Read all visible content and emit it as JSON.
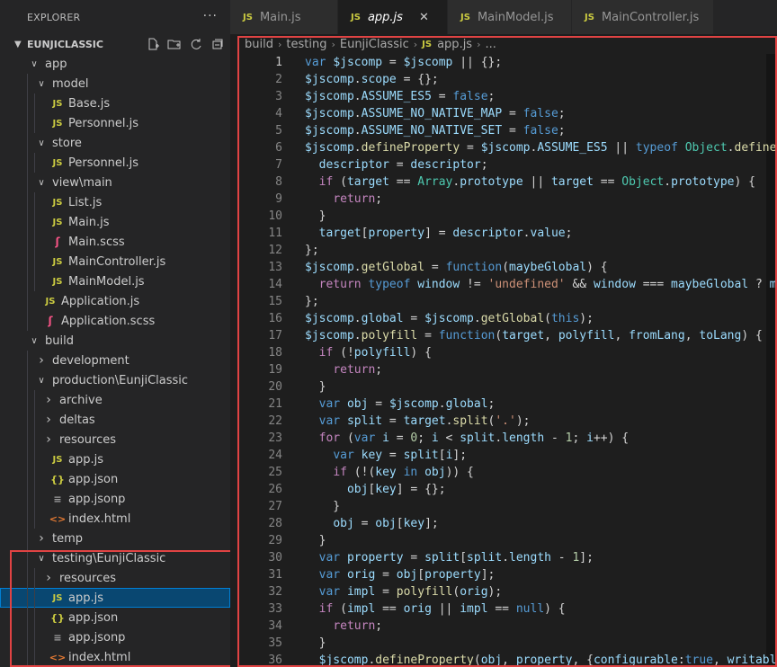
{
  "sidebar": {
    "title": "EXPLORER",
    "more": "···",
    "section": "EUNJICLASSIC",
    "tree": [
      {
        "label": "app",
        "type": "folder",
        "depth": 0,
        "open": true
      },
      {
        "label": "model",
        "type": "folder",
        "depth": 1,
        "open": true
      },
      {
        "label": "Base.js",
        "type": "js",
        "depth": 2
      },
      {
        "label": "Personnel.js",
        "type": "js",
        "depth": 2
      },
      {
        "label": "store",
        "type": "folder",
        "depth": 1,
        "open": true
      },
      {
        "label": "Personnel.js",
        "type": "js",
        "depth": 2
      },
      {
        "label": "view\\main",
        "type": "folder",
        "depth": 1,
        "open": true
      },
      {
        "label": "List.js",
        "type": "js",
        "depth": 2
      },
      {
        "label": "Main.js",
        "type": "js",
        "depth": 2
      },
      {
        "label": "Main.scss",
        "type": "sass",
        "depth": 2
      },
      {
        "label": "MainController.js",
        "type": "js",
        "depth": 2
      },
      {
        "label": "MainModel.js",
        "type": "js",
        "depth": 2
      },
      {
        "label": "Application.js",
        "type": "js",
        "depth": 1
      },
      {
        "label": "Application.scss",
        "type": "sass",
        "depth": 1
      },
      {
        "label": "build",
        "type": "folder",
        "depth": 0,
        "open": true
      },
      {
        "label": "development",
        "type": "folder",
        "depth": 1,
        "open": false
      },
      {
        "label": "production\\EunjiClassic",
        "type": "folder",
        "depth": 1,
        "open": true
      },
      {
        "label": "archive",
        "type": "folder",
        "depth": 2,
        "open": false
      },
      {
        "label": "deltas",
        "type": "folder",
        "depth": 2,
        "open": false
      },
      {
        "label": "resources",
        "type": "folder",
        "depth": 2,
        "open": false
      },
      {
        "label": "app.js",
        "type": "js",
        "depth": 2
      },
      {
        "label": "app.json",
        "type": "json",
        "depth": 2
      },
      {
        "label": "app.jsonp",
        "type": "text",
        "depth": 2
      },
      {
        "label": "index.html",
        "type": "html",
        "depth": 2
      },
      {
        "label": "temp",
        "type": "folder",
        "depth": 1,
        "open": false
      },
      {
        "label": "testing\\EunjiClassic",
        "type": "folder",
        "depth": 1,
        "open": true
      },
      {
        "label": "resources",
        "type": "folder",
        "depth": 2,
        "open": false
      },
      {
        "label": "app.js",
        "type": "js",
        "depth": 2,
        "selected": true
      },
      {
        "label": "app.json",
        "type": "json",
        "depth": 2
      },
      {
        "label": "app.jsonp",
        "type": "text",
        "depth": 2
      },
      {
        "label": "index.html",
        "type": "html",
        "depth": 2
      }
    ]
  },
  "tabs": [
    {
      "label": "Main.js",
      "active": false
    },
    {
      "label": "app.js",
      "active": true
    },
    {
      "label": "MainModel.js",
      "active": false
    },
    {
      "label": "MainController.js",
      "active": false
    }
  ],
  "icons": {
    "js": "JS",
    "json": "{}",
    "sass": "ʃ",
    "html": "<>",
    "text": "≡",
    "close": "✕"
  },
  "breadcrumb": [
    "build",
    "testing",
    "EunjiClassic",
    "app.js",
    "..."
  ],
  "editor": {
    "current_line": 1,
    "lines": [
      [
        [
          "k",
          "var "
        ],
        [
          "v",
          "$jscomp"
        ],
        [
          "p",
          " = "
        ],
        [
          "v",
          "$jscomp"
        ],
        [
          "p",
          " || {};"
        ]
      ],
      [
        [
          "v",
          "$jscomp"
        ],
        [
          "p",
          "."
        ],
        [
          "v",
          "scope"
        ],
        [
          "p",
          " = {};"
        ]
      ],
      [
        [
          "v",
          "$jscomp"
        ],
        [
          "p",
          "."
        ],
        [
          "v",
          "ASSUME_ES5"
        ],
        [
          "p",
          " = "
        ],
        [
          "k",
          "false"
        ],
        [
          "p",
          ";"
        ]
      ],
      [
        [
          "v",
          "$jscomp"
        ],
        [
          "p",
          "."
        ],
        [
          "v",
          "ASSUME_NO_NATIVE_MAP"
        ],
        [
          "p",
          " = "
        ],
        [
          "k",
          "false"
        ],
        [
          "p",
          ";"
        ]
      ],
      [
        [
          "v",
          "$jscomp"
        ],
        [
          "p",
          "."
        ],
        [
          "v",
          "ASSUME_NO_NATIVE_SET"
        ],
        [
          "p",
          " = "
        ],
        [
          "k",
          "false"
        ],
        [
          "p",
          ";"
        ]
      ],
      [
        [
          "v",
          "$jscomp"
        ],
        [
          "p",
          "."
        ],
        [
          "f",
          "defineProperty"
        ],
        [
          "p",
          " = "
        ],
        [
          "v",
          "$jscomp"
        ],
        [
          "p",
          "."
        ],
        [
          "v",
          "ASSUME_ES5"
        ],
        [
          "p",
          " || "
        ],
        [
          "k",
          "typeof "
        ],
        [
          "t",
          "Object"
        ],
        [
          "p",
          "."
        ],
        [
          "f",
          "defineProperty"
        ]
      ],
      [
        [
          "p",
          "  "
        ],
        [
          "v",
          "descriptor"
        ],
        [
          "p",
          " = "
        ],
        [
          "v",
          "descriptor"
        ],
        [
          "p",
          ";"
        ]
      ],
      [
        [
          "p",
          "  "
        ],
        [
          "c",
          "if"
        ],
        [
          "p",
          " ("
        ],
        [
          "v",
          "target"
        ],
        [
          "p",
          " == "
        ],
        [
          "t",
          "Array"
        ],
        [
          "p",
          "."
        ],
        [
          "v",
          "prototype"
        ],
        [
          "p",
          " || "
        ],
        [
          "v",
          "target"
        ],
        [
          "p",
          " == "
        ],
        [
          "t",
          "Object"
        ],
        [
          "p",
          "."
        ],
        [
          "v",
          "prototype"
        ],
        [
          "p",
          ") {"
        ]
      ],
      [
        [
          "p",
          "    "
        ],
        [
          "c",
          "return"
        ],
        [
          "p",
          ";"
        ]
      ],
      [
        [
          "p",
          "  }"
        ]
      ],
      [
        [
          "p",
          "  "
        ],
        [
          "v",
          "target"
        ],
        [
          "p",
          "["
        ],
        [
          "v",
          "property"
        ],
        [
          "p",
          "] = "
        ],
        [
          "v",
          "descriptor"
        ],
        [
          "p",
          "."
        ],
        [
          "v",
          "value"
        ],
        [
          "p",
          ";"
        ]
      ],
      [
        [
          "p",
          "};"
        ]
      ],
      [
        [
          "v",
          "$jscomp"
        ],
        [
          "p",
          "."
        ],
        [
          "f",
          "getGlobal"
        ],
        [
          "p",
          " = "
        ],
        [
          "k",
          "function"
        ],
        [
          "p",
          "("
        ],
        [
          "v",
          "maybeGlobal"
        ],
        [
          "p",
          ") {"
        ]
      ],
      [
        [
          "p",
          "  "
        ],
        [
          "c",
          "return "
        ],
        [
          "k",
          "typeof "
        ],
        [
          "v",
          "window"
        ],
        [
          "p",
          " != "
        ],
        [
          "s",
          "'undefined'"
        ],
        [
          "p",
          " && "
        ],
        [
          "v",
          "window"
        ],
        [
          "p",
          " === "
        ],
        [
          "v",
          "maybeGlobal"
        ],
        [
          "p",
          " ? "
        ],
        [
          "v",
          "maybeGlobal"
        ]
      ],
      [
        [
          "p",
          "};"
        ]
      ],
      [
        [
          "v",
          "$jscomp"
        ],
        [
          "p",
          "."
        ],
        [
          "v",
          "global"
        ],
        [
          "p",
          " = "
        ],
        [
          "v",
          "$jscomp"
        ],
        [
          "p",
          "."
        ],
        [
          "f",
          "getGlobal"
        ],
        [
          "p",
          "("
        ],
        [
          "k",
          "this"
        ],
        [
          "p",
          ");"
        ]
      ],
      [
        [
          "v",
          "$jscomp"
        ],
        [
          "p",
          "."
        ],
        [
          "f",
          "polyfill"
        ],
        [
          "p",
          " = "
        ],
        [
          "k",
          "function"
        ],
        [
          "p",
          "("
        ],
        [
          "v",
          "target"
        ],
        [
          "p",
          ", "
        ],
        [
          "v",
          "polyfill"
        ],
        [
          "p",
          ", "
        ],
        [
          "v",
          "fromLang"
        ],
        [
          "p",
          ", "
        ],
        [
          "v",
          "toLang"
        ],
        [
          "p",
          ") {"
        ]
      ],
      [
        [
          "p",
          "  "
        ],
        [
          "c",
          "if"
        ],
        [
          "p",
          " (!"
        ],
        [
          "v",
          "polyfill"
        ],
        [
          "p",
          ") {"
        ]
      ],
      [
        [
          "p",
          "    "
        ],
        [
          "c",
          "return"
        ],
        [
          "p",
          ";"
        ]
      ],
      [
        [
          "p",
          "  }"
        ]
      ],
      [
        [
          "p",
          "  "
        ],
        [
          "k",
          "var "
        ],
        [
          "v",
          "obj"
        ],
        [
          "p",
          " = "
        ],
        [
          "v",
          "$jscomp"
        ],
        [
          "p",
          "."
        ],
        [
          "v",
          "global"
        ],
        [
          "p",
          ";"
        ]
      ],
      [
        [
          "p",
          "  "
        ],
        [
          "k",
          "var "
        ],
        [
          "v",
          "split"
        ],
        [
          "p",
          " = "
        ],
        [
          "v",
          "target"
        ],
        [
          "p",
          "."
        ],
        [
          "f",
          "split"
        ],
        [
          "p",
          "("
        ],
        [
          "s",
          "'.'"
        ],
        [
          "p",
          ");"
        ]
      ],
      [
        [
          "p",
          "  "
        ],
        [
          "c",
          "for"
        ],
        [
          "p",
          " ("
        ],
        [
          "k",
          "var "
        ],
        [
          "v",
          "i"
        ],
        [
          "p",
          " = "
        ],
        [
          "n",
          "0"
        ],
        [
          "p",
          "; "
        ],
        [
          "v",
          "i"
        ],
        [
          "p",
          " < "
        ],
        [
          "v",
          "split"
        ],
        [
          "p",
          "."
        ],
        [
          "v",
          "length"
        ],
        [
          "p",
          " - "
        ],
        [
          "n",
          "1"
        ],
        [
          "p",
          "; "
        ],
        [
          "v",
          "i"
        ],
        [
          "p",
          "++) {"
        ]
      ],
      [
        [
          "p",
          "    "
        ],
        [
          "k",
          "var "
        ],
        [
          "v",
          "key"
        ],
        [
          "p",
          " = "
        ],
        [
          "v",
          "split"
        ],
        [
          "p",
          "["
        ],
        [
          "v",
          "i"
        ],
        [
          "p",
          "];"
        ]
      ],
      [
        [
          "p",
          "    "
        ],
        [
          "c",
          "if"
        ],
        [
          "p",
          " (!("
        ],
        [
          "v",
          "key"
        ],
        [
          "p",
          " "
        ],
        [
          "k",
          "in"
        ],
        [
          "p",
          " "
        ],
        [
          "v",
          "obj"
        ],
        [
          "p",
          ")) {"
        ]
      ],
      [
        [
          "p",
          "      "
        ],
        [
          "v",
          "obj"
        ],
        [
          "p",
          "["
        ],
        [
          "v",
          "key"
        ],
        [
          "p",
          "] = {};"
        ]
      ],
      [
        [
          "p",
          "    }"
        ]
      ],
      [
        [
          "p",
          "    "
        ],
        [
          "v",
          "obj"
        ],
        [
          "p",
          " = "
        ],
        [
          "v",
          "obj"
        ],
        [
          "p",
          "["
        ],
        [
          "v",
          "key"
        ],
        [
          "p",
          "];"
        ]
      ],
      [
        [
          "p",
          "  }"
        ]
      ],
      [
        [
          "p",
          "  "
        ],
        [
          "k",
          "var "
        ],
        [
          "v",
          "property"
        ],
        [
          "p",
          " = "
        ],
        [
          "v",
          "split"
        ],
        [
          "p",
          "["
        ],
        [
          "v",
          "split"
        ],
        [
          "p",
          "."
        ],
        [
          "v",
          "length"
        ],
        [
          "p",
          " - "
        ],
        [
          "n",
          "1"
        ],
        [
          "p",
          "];"
        ]
      ],
      [
        [
          "p",
          "  "
        ],
        [
          "k",
          "var "
        ],
        [
          "v",
          "orig"
        ],
        [
          "p",
          " = "
        ],
        [
          "v",
          "obj"
        ],
        [
          "p",
          "["
        ],
        [
          "v",
          "property"
        ],
        [
          "p",
          "];"
        ]
      ],
      [
        [
          "p",
          "  "
        ],
        [
          "k",
          "var "
        ],
        [
          "v",
          "impl"
        ],
        [
          "p",
          " = "
        ],
        [
          "f",
          "polyfill"
        ],
        [
          "p",
          "("
        ],
        [
          "v",
          "orig"
        ],
        [
          "p",
          ");"
        ]
      ],
      [
        [
          "p",
          "  "
        ],
        [
          "c",
          "if"
        ],
        [
          "p",
          " ("
        ],
        [
          "v",
          "impl"
        ],
        [
          "p",
          " == "
        ],
        [
          "v",
          "orig"
        ],
        [
          "p",
          " || "
        ],
        [
          "v",
          "impl"
        ],
        [
          "p",
          " == "
        ],
        [
          "k",
          "null"
        ],
        [
          "p",
          ") {"
        ]
      ],
      [
        [
          "p",
          "    "
        ],
        [
          "c",
          "return"
        ],
        [
          "p",
          ";"
        ]
      ],
      [
        [
          "p",
          "  }"
        ]
      ],
      [
        [
          "p",
          "  "
        ],
        [
          "v",
          "$jscomp"
        ],
        [
          "p",
          "."
        ],
        [
          "f",
          "defineProperty"
        ],
        [
          "p",
          "("
        ],
        [
          "v",
          "obj"
        ],
        [
          "p",
          ", "
        ],
        [
          "v",
          "property"
        ],
        [
          "p",
          ", {"
        ],
        [
          "v",
          "configurable"
        ],
        [
          "p",
          ":"
        ],
        [
          "k",
          "true"
        ],
        [
          "p",
          ", "
        ],
        [
          "v",
          "writable"
        ]
      ]
    ]
  }
}
